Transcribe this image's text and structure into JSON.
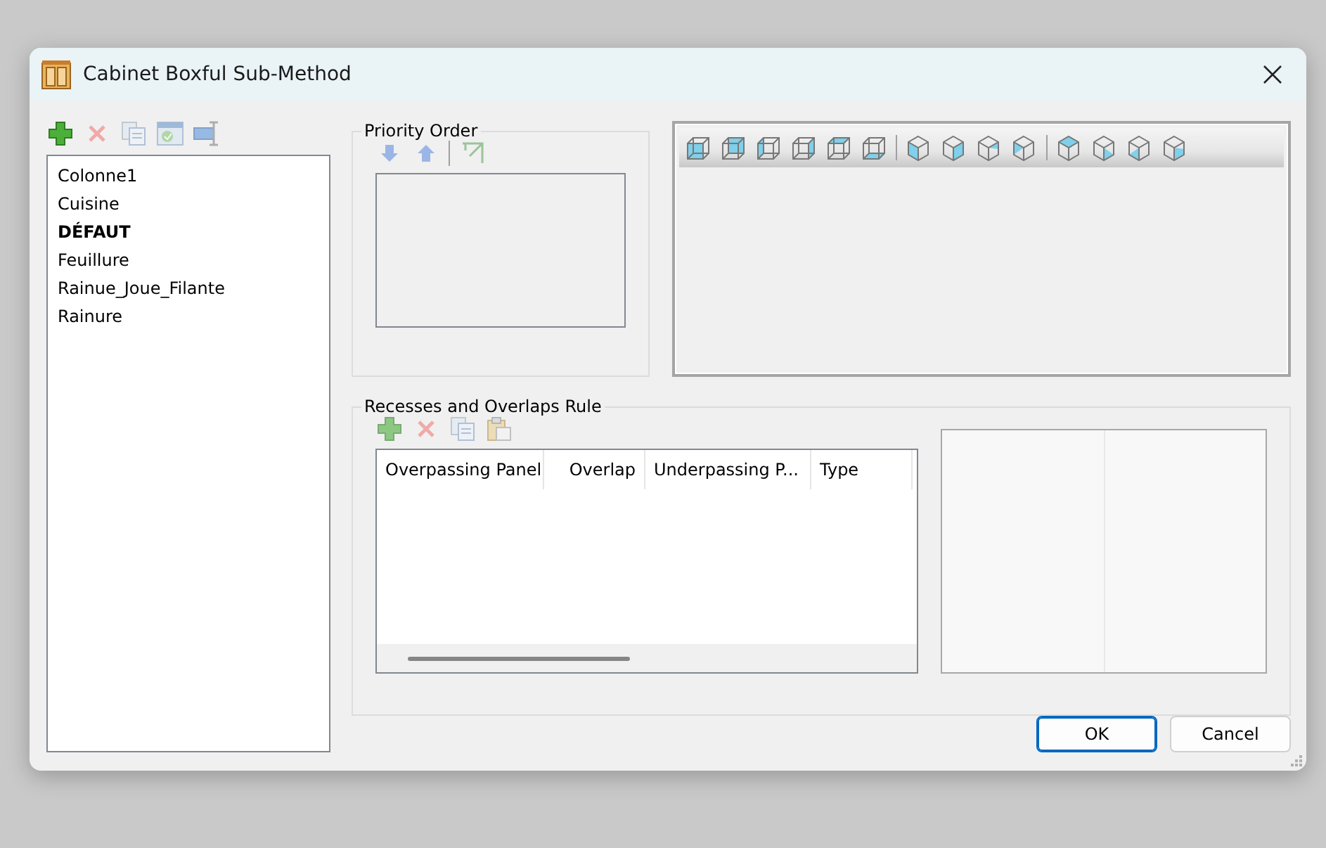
{
  "window": {
    "title": "Cabinet Boxful Sub-Method"
  },
  "sub_methods": [
    {
      "name": "Colonne1",
      "is_default": false
    },
    {
      "name": "Cuisine",
      "is_default": false
    },
    {
      "name": "DÉFAUT",
      "is_default": true
    },
    {
      "name": "Feuillure",
      "is_default": false
    },
    {
      "name": "Rainue_Joue_Filante",
      "is_default": false
    },
    {
      "name": "Rainure",
      "is_default": false
    }
  ],
  "priority_order": {
    "title": "Priority Order"
  },
  "recesses": {
    "title": "Recesses and Overlaps Rule",
    "columns": [
      "Overpassing Panel",
      "Overlap",
      "Underpassing P...",
      "Type"
    ]
  },
  "buttons": [
    {
      "label": "OK",
      "default": true
    },
    {
      "label": "Cancel",
      "default": false
    }
  ]
}
